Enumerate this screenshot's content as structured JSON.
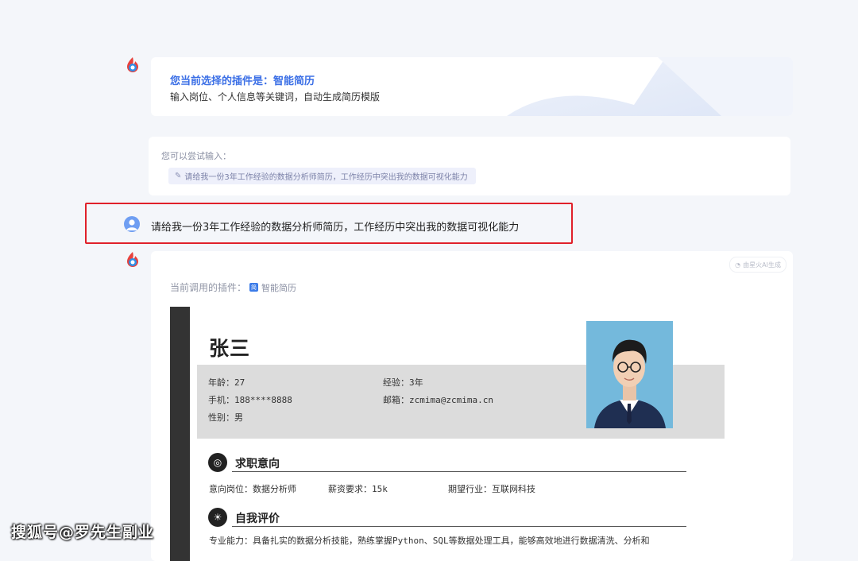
{
  "plugin_card": {
    "title": "您当前选择的插件是：智能简历",
    "description": "输入岗位、个人信息等关键词，自动生成简历模版"
  },
  "suggestion": {
    "label": "您可以尝试输入：",
    "chip_icon": "pencil-icon",
    "chip_text": "请给我一份3年工作经验的数据分析师简历，工作经历中突出我的数据可视化能力"
  },
  "user_message": {
    "text": "请给我一份3年工作经验的数据分析师简历，工作经历中突出我的数据可视化能力",
    "highlight_color": "#e0202a"
  },
  "response": {
    "ai_badge": "由星火AI生成",
    "plugin_label": "当前调用的插件：",
    "plugin_name": "智能简历"
  },
  "resume": {
    "name": "张三",
    "age": "年龄：27",
    "experience": "经验：3年",
    "phone": "手机：188****8888",
    "email": "邮箱：zcmima@zcmima.cn",
    "gender": "性别：男",
    "sections": [
      {
        "icon": "target-icon",
        "title": "求职意向"
      },
      {
        "icon": "lightbulb-icon",
        "title": "自我评价"
      }
    ],
    "intent": {
      "position": "意向岗位：数据分析师",
      "salary": "薪资要求：15k",
      "industry": "期望行业：互联网科技"
    },
    "self_eval": "专业能力：具备扎实的数据分析技能，熟练掌握Python、SQL等数据处理工具，能够高效地进行数据清洗、分析和"
  },
  "watermark": "搜狐号@罗先生副业",
  "colors": {
    "accent": "#3b6fe6",
    "background": "#f4f6fa",
    "resume_bar": "#333333"
  }
}
